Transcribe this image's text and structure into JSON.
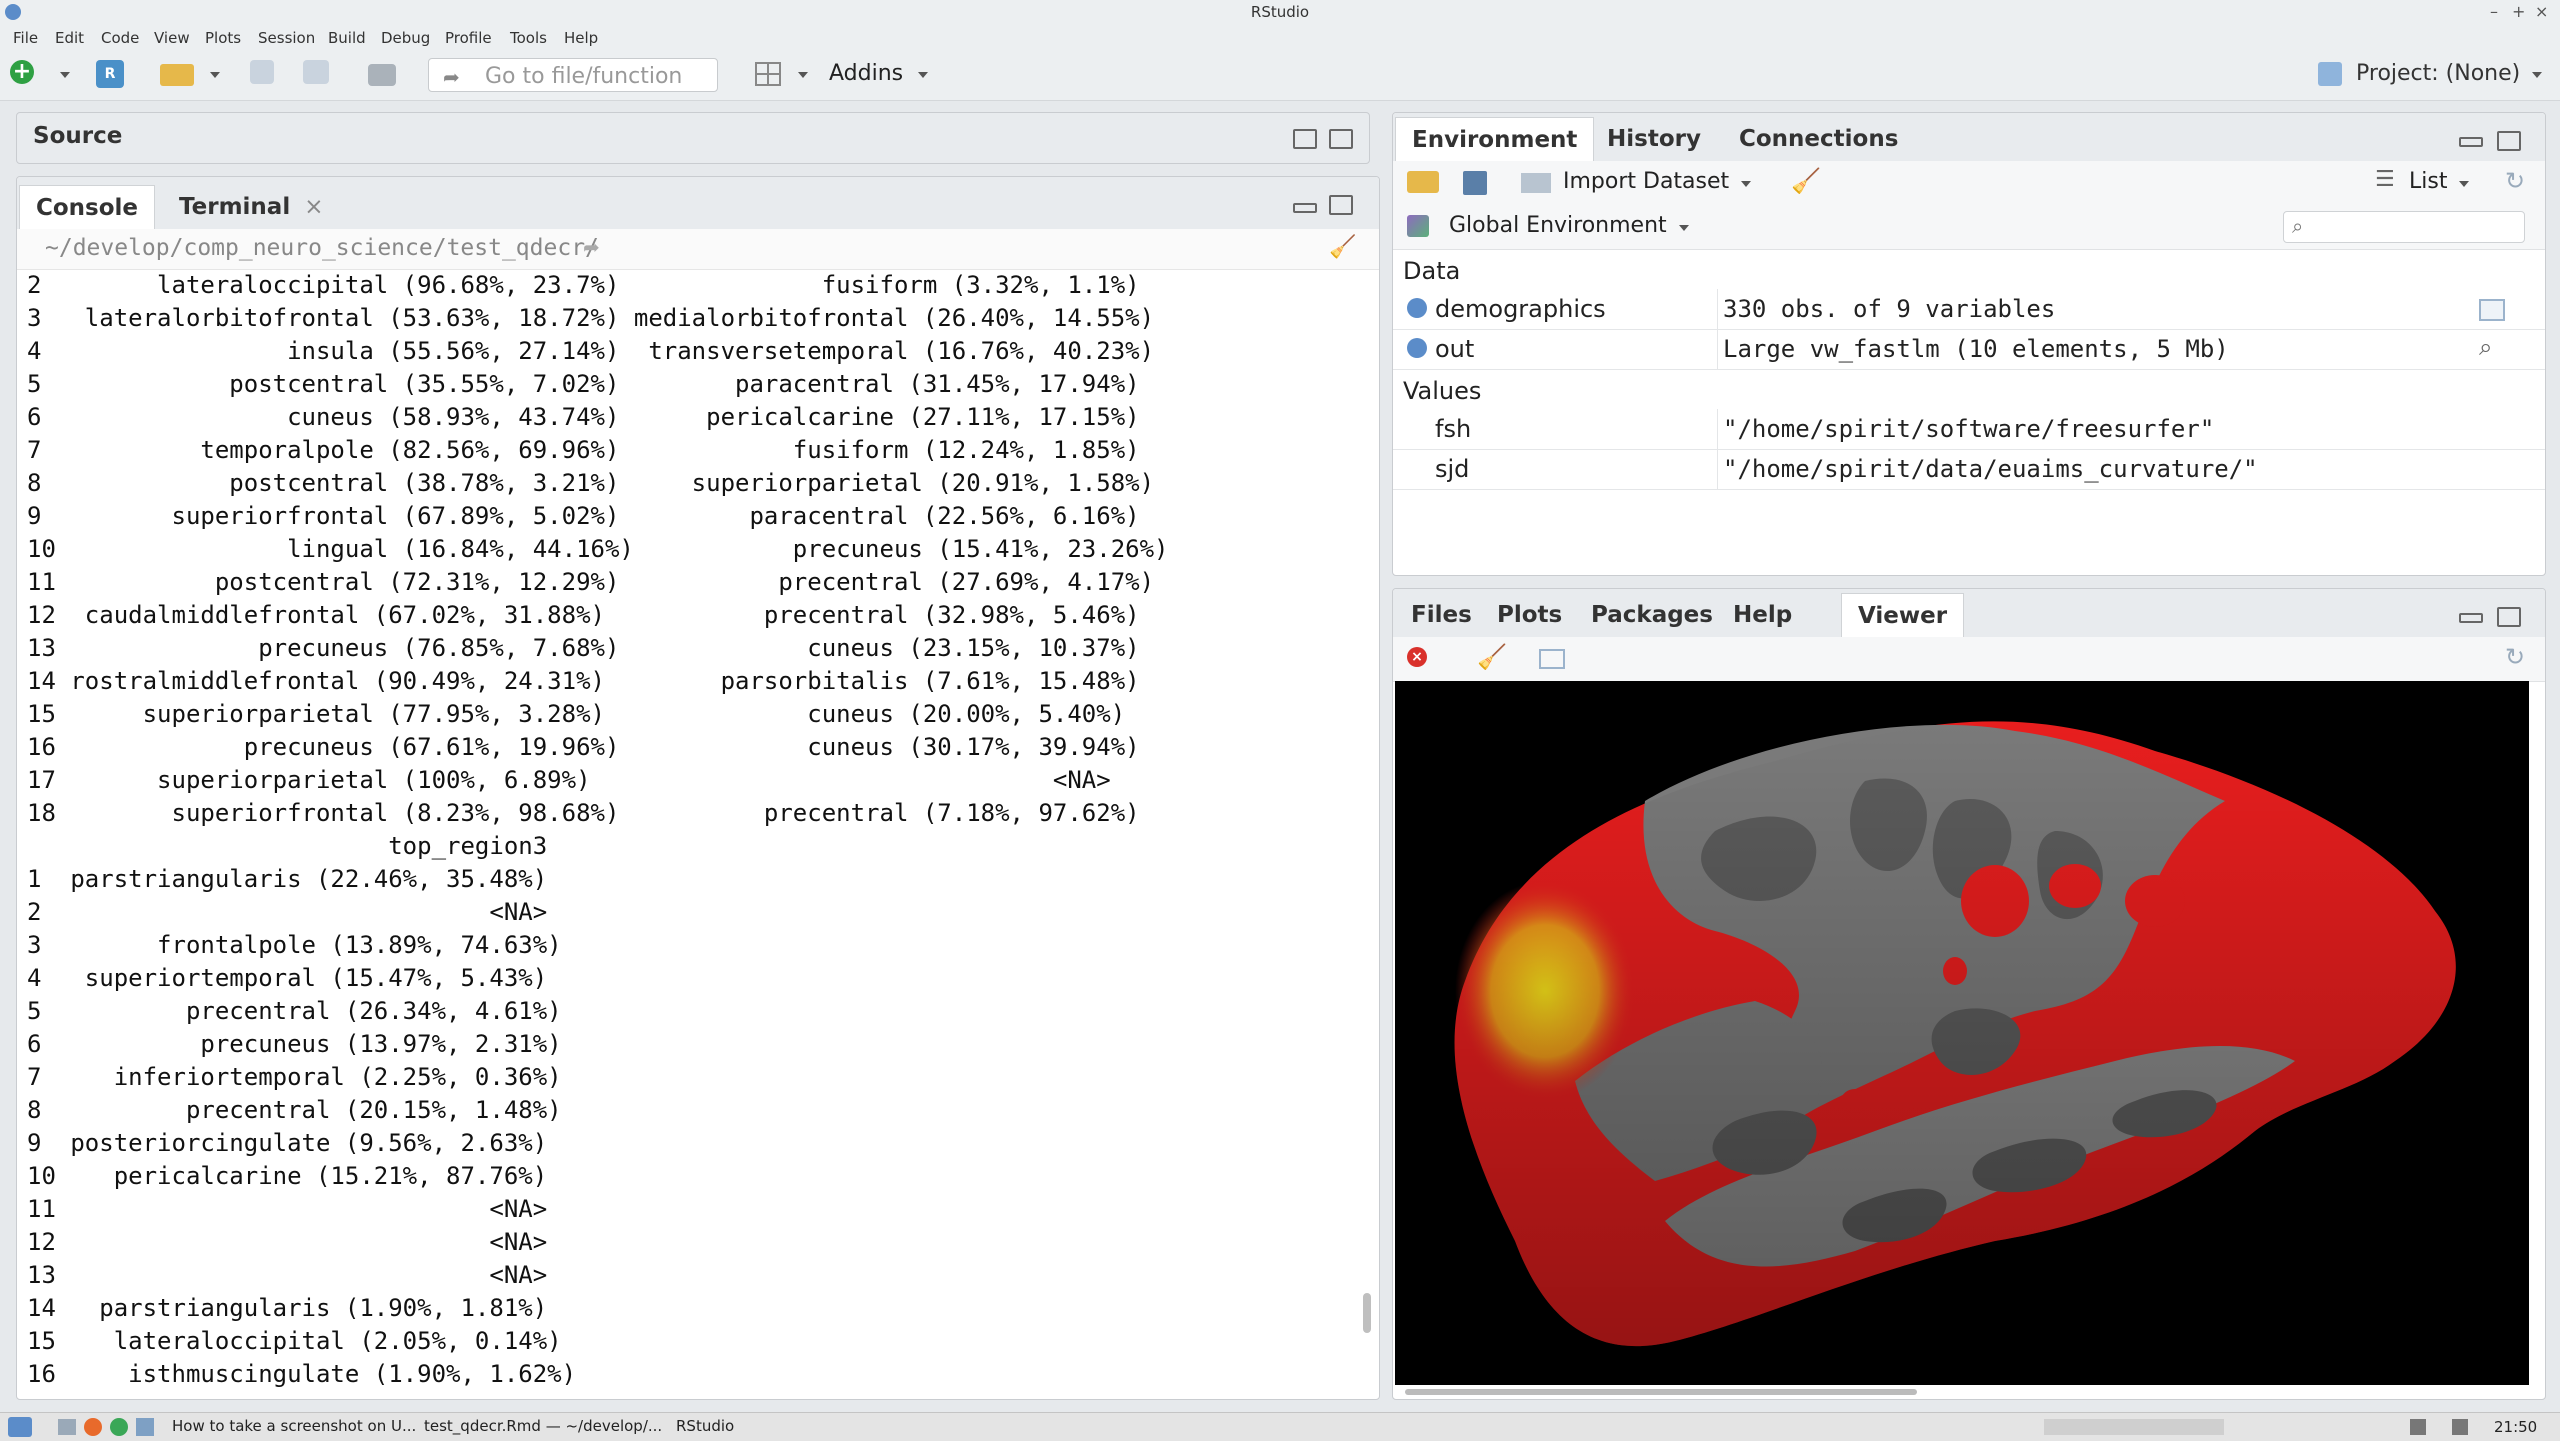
{
  "window": {
    "title": "RStudio"
  },
  "menu": [
    "File",
    "Edit",
    "Code",
    "View",
    "Plots",
    "Session",
    "Build",
    "Debug",
    "Profile",
    "Tools",
    "Help"
  ],
  "toolbar": {
    "goto_placeholder": "Go to file/function",
    "addins_label": "Addins",
    "project_label": "Project: (None)"
  },
  "source_pane": {
    "title": "Source"
  },
  "console_pane": {
    "tabs": [
      "Console",
      "Terminal"
    ],
    "path": "~/develop/comp_neuro_science/test_qdecr/",
    "lines": [
      "2        lateraloccipital (96.68%, 23.7%)              fusiform (3.32%, 1.1%)",
      "3   lateralorbitofrontal (53.63%, 18.72%) medialorbitofrontal (26.40%, 14.55%)",
      "4                 insula (55.56%, 27.14%)  transversetemporal (16.76%, 40.23%)",
      "5             postcentral (35.55%, 7.02%)        paracentral (31.45%, 17.94%)",
      "6                 cuneus (58.93%, 43.74%)      pericalcarine (27.11%, 17.15%)",
      "7           temporalpole (82.56%, 69.96%)            fusiform (12.24%, 1.85%)",
      "8             postcentral (38.78%, 3.21%)     superiorparietal (20.91%, 1.58%)",
      "9         superiorfrontal (67.89%, 5.02%)         paracentral (22.56%, 6.16%)",
      "10                lingual (16.84%, 44.16%)           precuneus (15.41%, 23.26%)",
      "11           postcentral (72.31%, 12.29%)           precentral (27.69%, 4.17%)",
      "12  caudalmiddlefrontal (67.02%, 31.88%)           precentral (32.98%, 5.46%)",
      "13              precuneus (76.85%, 7.68%)             cuneus (23.15%, 10.37%)",
      "14 rostralmiddlefrontal (90.49%, 24.31%)        parsorbitalis (7.61%, 15.48%)",
      "15      superiorparietal (77.95%, 3.28%)              cuneus (20.00%, 5.40%)",
      "16             precuneus (67.61%, 19.96%)             cuneus (30.17%, 39.94%)",
      "17       superiorparietal (100%, 6.89%)                                <NA>",
      "18        superiorfrontal (8.23%, 98.68%)          precentral (7.18%, 97.62%)",
      "                         top_region3",
      "1  parstriangularis (22.46%, 35.48%)",
      "2                               <NA>",
      "3        frontalpole (13.89%, 74.63%)",
      "4   superiortemporal (15.47%, 5.43%)",
      "5          precentral (26.34%, 4.61%)",
      "6           precuneus (13.97%, 2.31%)",
      "7     inferiortemporal (2.25%, 0.36%)",
      "8          precentral (20.15%, 1.48%)",
      "9  posteriorcingulate (9.56%, 2.63%)",
      "10    pericalcarine (15.21%, 87.76%)",
      "11                              <NA>",
      "12                              <NA>",
      "13                              <NA>",
      "14   parstriangularis (1.90%, 1.81%)",
      "15    lateraloccipital (2.05%, 0.14%)",
      "16     isthmuscingulate (1.90%, 1.62%)"
    ]
  },
  "env_pane": {
    "tabs": [
      "Environment",
      "History",
      "Connections"
    ],
    "import_label": "Import Dataset",
    "list_label": "List",
    "scope_label": "Global Environment",
    "section_data": "Data",
    "section_values": "Values",
    "data_rows": [
      {
        "name": "demographics",
        "value": "330 obs. of 9 variables"
      },
      {
        "name": "out",
        "value": "Large vw_fastlm (10 elements, 5 Mb)"
      }
    ],
    "value_rows": [
      {
        "name": "fsh",
        "value": "\"/home/spirit/software/freesurfer\""
      },
      {
        "name": "sjd",
        "value": "\"/home/spirit/data/euaims_curvature/\""
      }
    ]
  },
  "viewer_pane": {
    "tabs": [
      "Files",
      "Plots",
      "Packages",
      "Help",
      "Viewer"
    ],
    "active": "Viewer"
  },
  "taskbar": {
    "tasks": [
      "How to take a screenshot on U...",
      "test_qdecr.Rmd — ~/develop/...",
      "RStudio"
    ],
    "clock": "21:50"
  },
  "colors": {
    "accent": "#4a90c8",
    "activation_red": "#e81e1e",
    "brain_gray": "#7a7a7a"
  }
}
